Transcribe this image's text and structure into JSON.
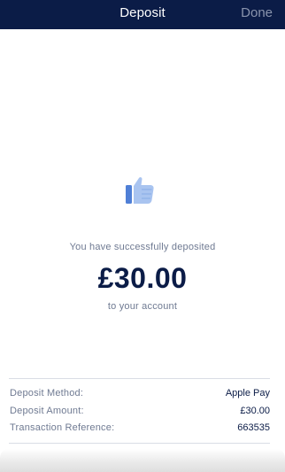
{
  "header": {
    "title": "Deposit",
    "done_label": "Done"
  },
  "icons": {
    "thumbs_up": "thumbs-up-icon"
  },
  "confirmation": {
    "message": "You have successfully deposited",
    "amount": "£30.00",
    "subtext": "to your account"
  },
  "details": [
    {
      "label": "Deposit Method:",
      "value": "Apple Pay"
    },
    {
      "label": "Deposit Amount:",
      "value": "£30.00"
    },
    {
      "label": "Transaction Reference:",
      "value": "663535"
    }
  ],
  "colors": {
    "header_bg": "#0b1c47",
    "amount_text": "#0b1c47",
    "muted_text": "#6f7a92",
    "thumb_light": "#a9c4f0",
    "thumb_dark": "#4f7fd6"
  }
}
